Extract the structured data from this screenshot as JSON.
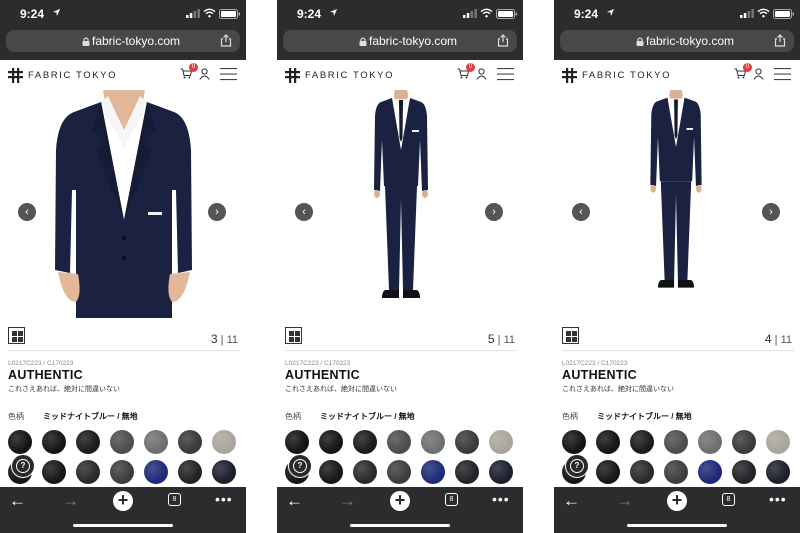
{
  "screens": [
    {
      "status": {
        "time": "9:24"
      },
      "browser": {
        "url": "fabric-tokyo.com",
        "tab_count": "8"
      },
      "header": {
        "logo": "FABRIC TOKYO",
        "cart_count": "0"
      },
      "gallery": {
        "view": "closeup",
        "current": "3",
        "separator": "|",
        "total": "11"
      },
      "product": {
        "code": "L0217C223 / C170223",
        "title": "AUTHENTIC",
        "tagline": "これさえあれば、絶対に間違いない",
        "color_label": "色柄",
        "color_value": "ミッドナイトブルー / 無地"
      },
      "help_label": "?"
    },
    {
      "status": {
        "time": "9:24"
      },
      "browser": {
        "url": "fabric-tokyo.com",
        "tab_count": "8"
      },
      "header": {
        "logo": "FABRIC TOKYO",
        "cart_count": "0"
      },
      "gallery": {
        "view": "full-body",
        "current": "5",
        "separator": "|",
        "total": "11"
      },
      "product": {
        "code": "L0217C223 / C170223",
        "title": "AUTHENTIC",
        "tagline": "これさえあれば、絶対に間違いない",
        "color_label": "色柄",
        "color_value": "ミッドナイトブルー / 無地"
      },
      "help_label": "?"
    },
    {
      "status": {
        "time": "9:24"
      },
      "browser": {
        "url": "fabric-tokyo.com",
        "tab_count": "8"
      },
      "header": {
        "logo": "FABRIC TOKYO",
        "cart_count": "0"
      },
      "gallery": {
        "view": "full-body-small",
        "current": "4",
        "separator": "|",
        "total": "11"
      },
      "product": {
        "code": "L0217C223 / C170223",
        "title": "AUTHENTIC",
        "tagline": "これさえあれば、絶対に間違いない",
        "color_label": "色柄",
        "color_value": "ミッドナイトブルー / 無地"
      },
      "help_label": "?"
    }
  ],
  "swatches": [
    "#141414",
    "#151515",
    "#1b1b1d",
    "#4c4d4f",
    "#6e6f71",
    "#3a3a3c",
    "#a9a59d",
    "#151515",
    "#171717",
    "#2a2a2c",
    "#3c3d3f",
    "#1e2a78",
    "#222326",
    "#1d1f2d"
  ],
  "colors": {
    "chrome": "#2c2c2e",
    "suit": "#1b2140",
    "badge": "#e04040"
  },
  "icons": {
    "left_arrow": "‹",
    "right_arrow": "›",
    "back": "←",
    "forward": "→",
    "new_tab": "+",
    "more": "•••"
  }
}
